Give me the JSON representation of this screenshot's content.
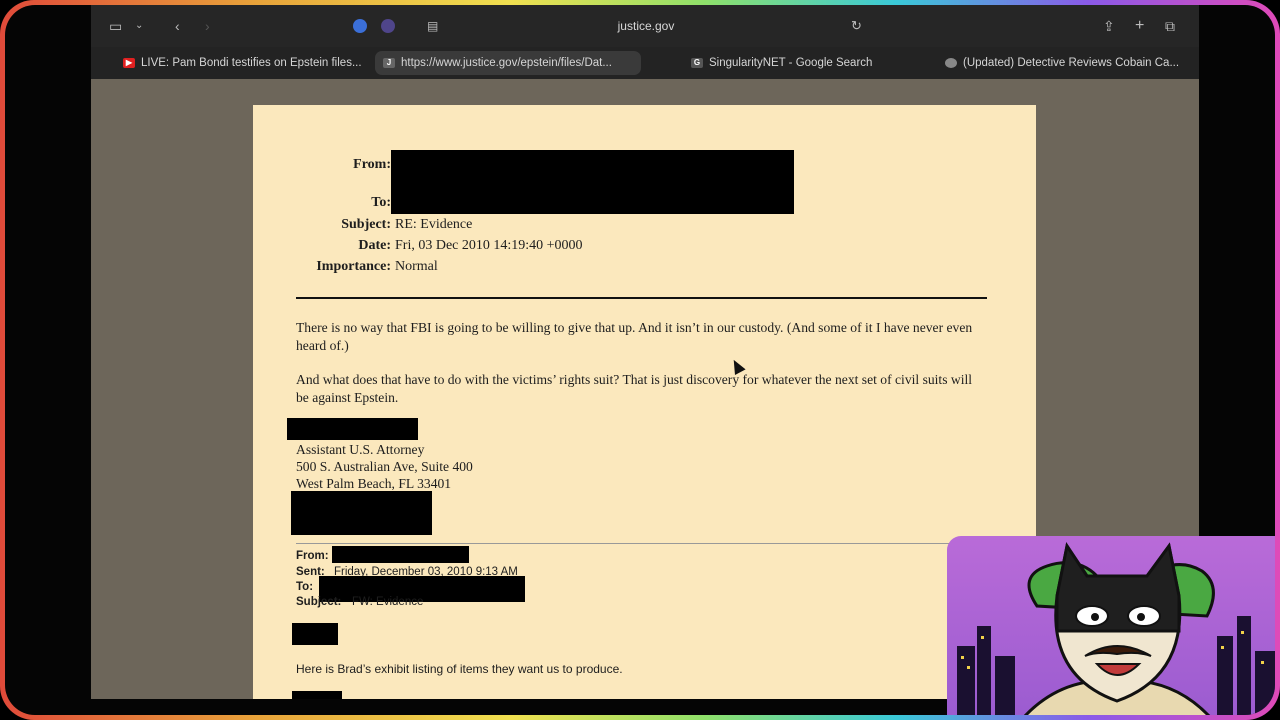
{
  "browser": {
    "address": "justice.gov",
    "tabs": [
      {
        "label": "LIVE: Pam Bondi testifies on Epstein files...",
        "favicon": "youtube-icon",
        "color": "#e02020"
      },
      {
        "label": "https://www.justice.gov/epstein/files/Dat...",
        "favicon": "J",
        "color": "#666666"
      },
      {
        "label": "SingularityNET - Google Search",
        "favicon": "G",
        "color": "#555555"
      },
      {
        "label": "(Updated) Detective Reviews Cobain Ca...",
        "favicon": "brain-icon",
        "color": "#666666"
      }
    ]
  },
  "email": {
    "from_label": "From:",
    "to_label": "To:",
    "subject_label": "Subject:",
    "subject": "RE: Evidence",
    "date_label": "Date:",
    "date": "Fri, 03 Dec 2010 14:19:40 +0000",
    "importance_label": "Importance:",
    "importance": "Normal",
    "para1": "There is no way that FBI is going to be willing to give that up.  And it isn’t in our custody.  (And some of it I have never even heard of.)",
    "para2": "And what does that have to do with the victims’ rights suit?  That is just discovery for whatever the next set of civil suits will be against Epstein.",
    "sig_title": "Assistant U.S. Attorney",
    "sig_addr1": "500 S. Australian Ave, Suite 400",
    "sig_addr2": "West Palm Beach, FL 33401"
  },
  "forwarded": {
    "from_label": "From:",
    "sent_label": "Sent:",
    "sent": "Friday, December 03, 2010 9:13 AM",
    "to_label": "To:",
    "subject_label": "Subject:",
    "subject": "FW: Evidence",
    "body": "Here is Brad’s exhibit listing of items they want us to produce."
  },
  "colors": {
    "page": "#fbe8bd",
    "viewport": "#6d665a",
    "toolbar": "#262626"
  }
}
